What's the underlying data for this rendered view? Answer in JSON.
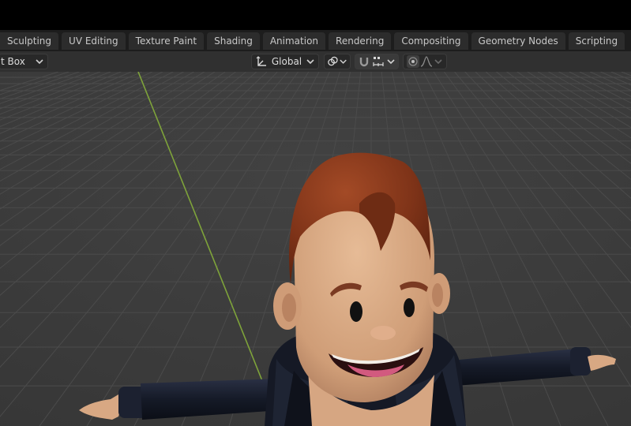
{
  "workspace_tabs": [
    "Sculpting",
    "UV Editing",
    "Texture Paint",
    "Shading",
    "Animation",
    "Rendering",
    "Compositing",
    "Geometry Nodes",
    "Scripting"
  ],
  "add_tab_label": "+",
  "header": {
    "select_mode_label": "t Box",
    "transform_orientation": "Global"
  },
  "colors": {
    "grid_axis_y": "#7ea33a",
    "skin": "#d8a883",
    "hair": "#8a3a20",
    "jacket": "#161a26"
  }
}
